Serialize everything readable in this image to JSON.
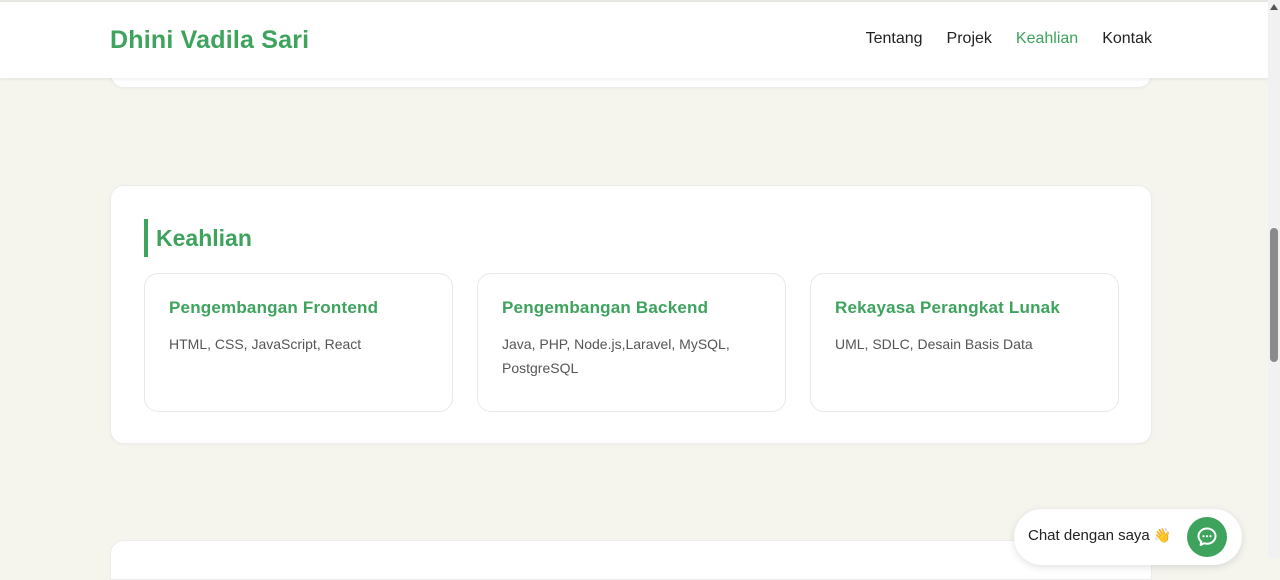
{
  "header": {
    "brand": "Dhini Vadila Sari",
    "nav": [
      "Tentang",
      "Projek",
      "Keahlian",
      "Kontak"
    ],
    "active_nav": "Keahlian"
  },
  "skills": {
    "title": "Keahlian",
    "items": [
      {
        "title": "Pengembangan Frontend",
        "desc": "HTML, CSS, JavaScript, React"
      },
      {
        "title": "Pengembangan Backend",
        "desc": "Java, PHP, Node.js,Laravel, MySQL, PostgreSQL"
      },
      {
        "title": "Rekayasa Perangkat Lunak",
        "desc": "UML, SDLC, Desain Basis Data"
      }
    ]
  },
  "chat": {
    "label": "Chat dengan saya",
    "emoji": "👋",
    "icon": "chat-bubble-icon"
  },
  "colors": {
    "accent": "#3da35d",
    "background": "#f5f5ee"
  }
}
